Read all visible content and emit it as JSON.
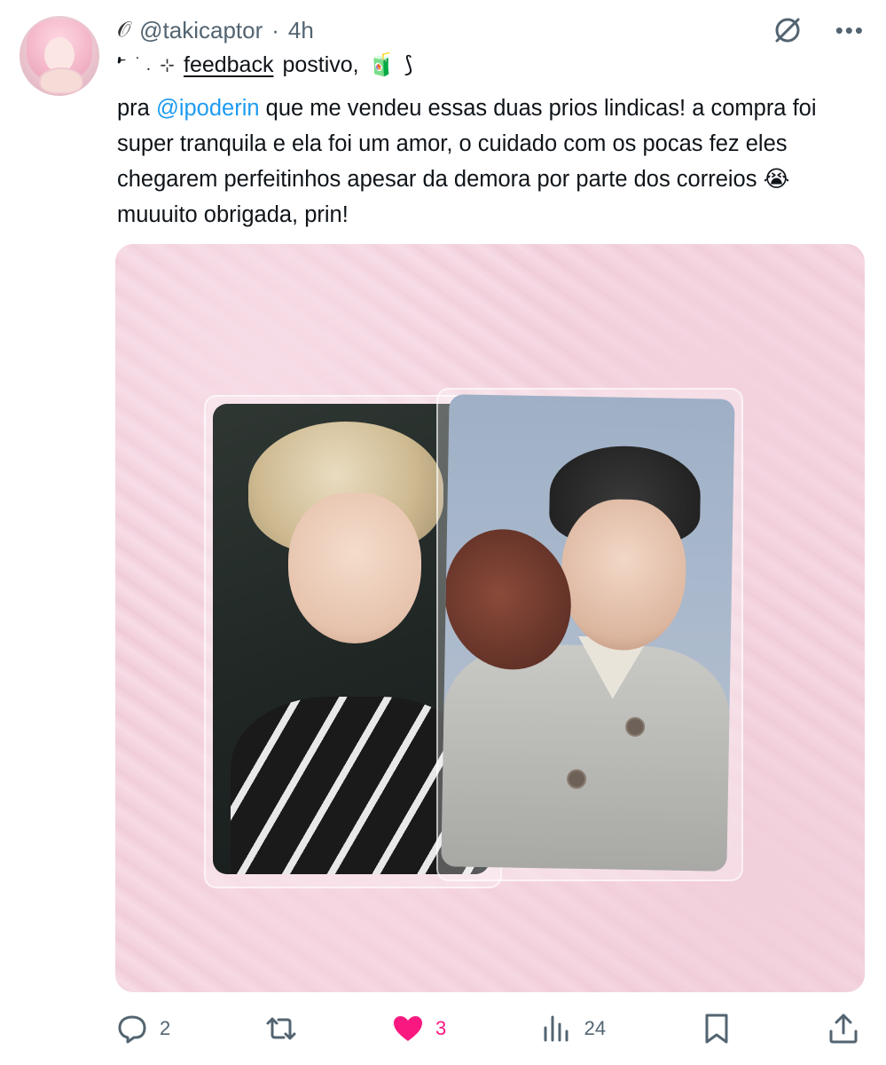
{
  "tweet": {
    "header": {
      "deco": "𝒪",
      "handle": "@takicaptor",
      "separator": "·",
      "time": "4h"
    },
    "line1": {
      "lead": "𝀁",
      "tiny_dots": "˙   .",
      "sparkle": "⊹",
      "feedback": "feedback",
      "postivo": "postivo,",
      "juice_emoji": "🧃",
      "thread_emoji": "⟆"
    },
    "text": {
      "part1": "pra ",
      "mention": "@ipoderin",
      "part2": " que me vendeu essas duas prios lindicas! a compra foi super tranquila e ela foi um amor, o cuidado com os pocas fez eles chegarem perfeitinhos apesar da demora por parte dos correios ",
      "emoji": "😭",
      "part3": " muuuito obrigada, prin!"
    },
    "actions": {
      "replies": "2",
      "likes": "3",
      "views": "24"
    },
    "colors": {
      "accent": "#1d9bf0",
      "like": "#f91880",
      "muted": "#536471"
    }
  }
}
